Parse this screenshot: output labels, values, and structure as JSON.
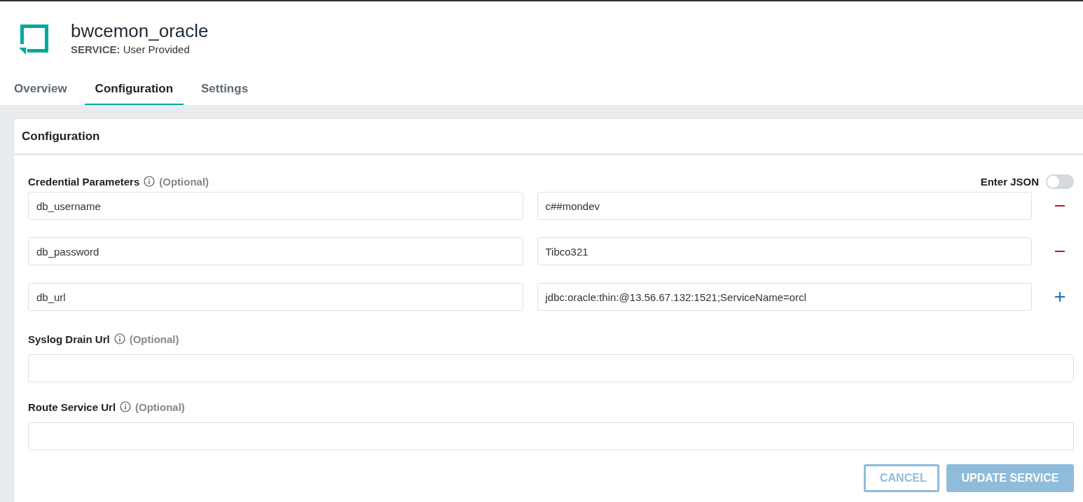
{
  "header": {
    "title": "bwcemon_oracle",
    "service_label": "SERVICE:",
    "service_value": "User Provided"
  },
  "tabs": [
    {
      "label": "Overview",
      "selected": false
    },
    {
      "label": "Configuration",
      "selected": true
    },
    {
      "label": "Settings",
      "selected": false
    }
  ],
  "card": {
    "title": "Configuration",
    "credentials": {
      "label": "Credential Parameters",
      "optional": "(Optional)",
      "json_toggle": {
        "label": "Enter JSON",
        "on": false
      },
      "rows": [
        {
          "key": "db_username",
          "value": "c##mondev",
          "kind": "remove"
        },
        {
          "key": "db_password",
          "value": "Tibco321",
          "kind": "remove"
        },
        {
          "key": "db_url",
          "value": "jdbc:oracle:thin:@13.56.67.132:1521;ServiceName=orcl",
          "kind": "add"
        }
      ]
    },
    "fields": [
      {
        "label": "Syslog Drain Url",
        "optional": "(Optional)"
      },
      {
        "label": "Route Service Url",
        "optional": "(Optional)"
      }
    ],
    "buttons": [
      {
        "label": "CANCEL",
        "kind": "secondary",
        "disabled": true
      },
      {
        "label": "UPDATE SERVICE",
        "kind": "primary",
        "disabled": true
      }
    ]
  }
}
